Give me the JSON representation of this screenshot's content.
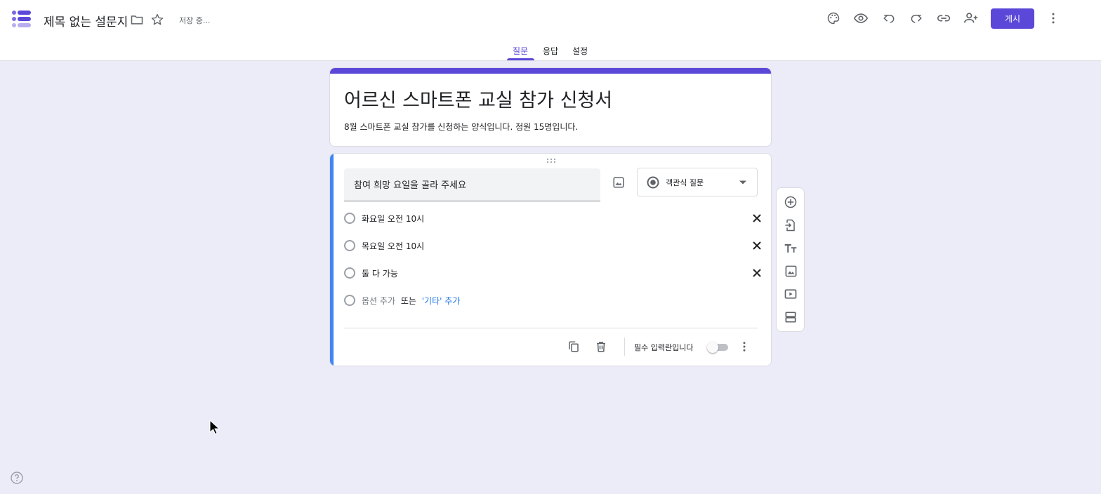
{
  "header": {
    "doc_title": "제목 없는 설문지",
    "save_status": "저장 중...",
    "publish_label": "게시",
    "icons": [
      "palette-icon",
      "preview-icon",
      "undo-icon",
      "redo-icon",
      "link-icon",
      "add-collaborator-icon",
      "more-vert-icon"
    ]
  },
  "tabs": [
    {
      "label": "질문",
      "active": true
    },
    {
      "label": "응답",
      "active": false
    },
    {
      "label": "설정",
      "active": false
    }
  ],
  "form": {
    "title": "어르신 스마트폰 교실 참가 신청서",
    "description": "8월 스마트폰 교실 참가를 신청하는 양식입니다. 정원 15명입니다."
  },
  "question": {
    "text": "참여 희망 요일을 골라 주세요",
    "type_label": "객관식 질문",
    "options": [
      {
        "label": "화요일 오전 10시"
      },
      {
        "label": "목요일 오전 10시"
      },
      {
        "label": "둘 다 가능"
      }
    ],
    "add_option_label": "옵션 추가",
    "or_label": "또는",
    "add_other_label": "'기타' 추가",
    "required_label": "필수 입력란입니다",
    "required": false
  },
  "colors": {
    "accent": "#5b48d9",
    "active_card_bar": "#4285f4",
    "background": "#ecebf8"
  }
}
